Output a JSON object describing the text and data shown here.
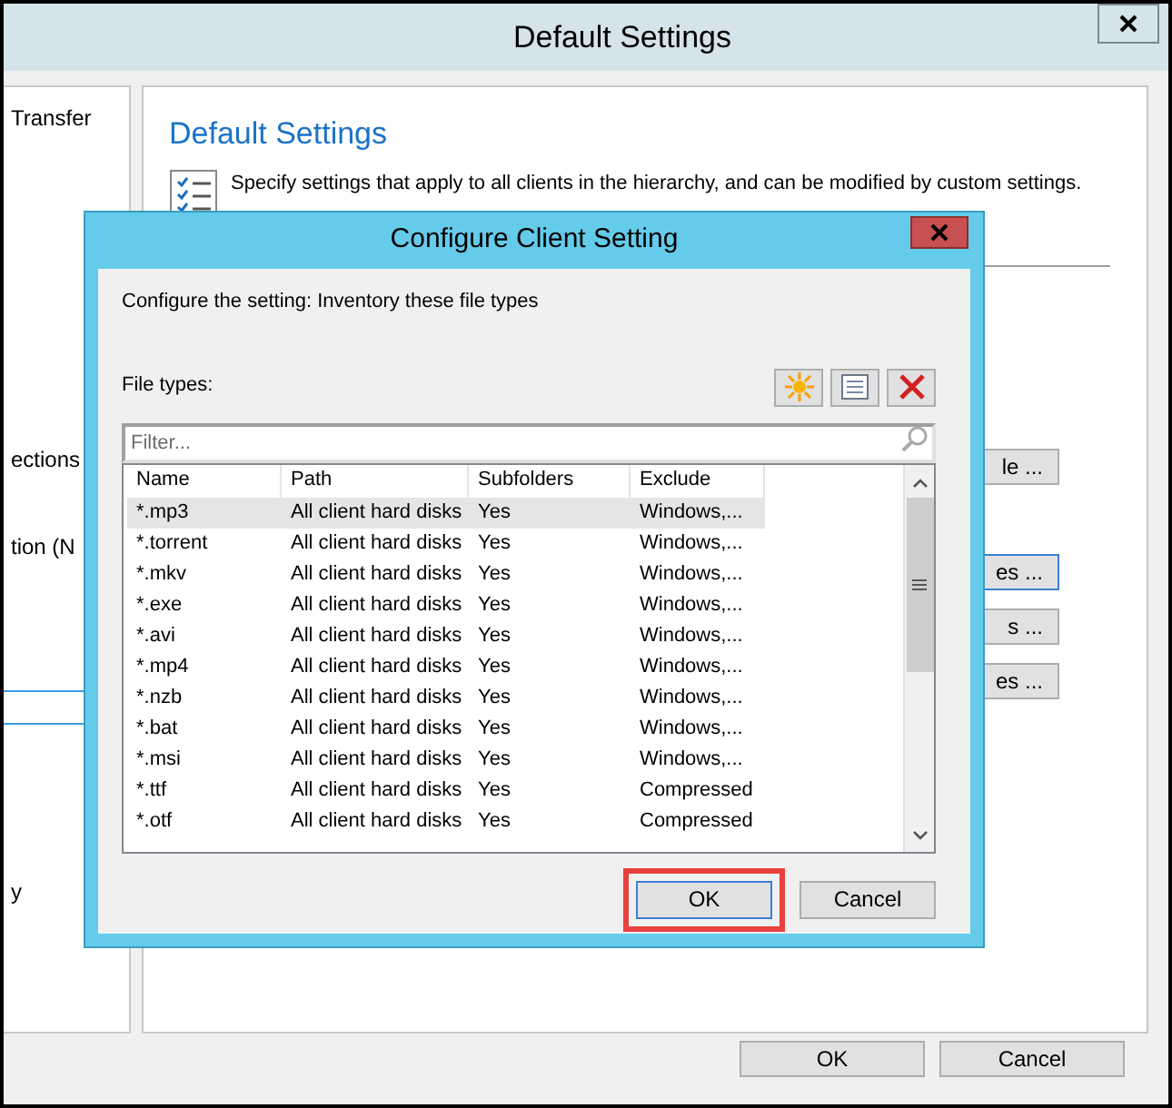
{
  "main_window": {
    "title": "Default Settings",
    "sidebar_items": [
      "Transfer",
      "ections",
      "tion (N",
      "y"
    ],
    "panel": {
      "heading": "Default Settings",
      "description": "Specify settings that apply to all clients in the hierarchy, and can be modified by custom settings.",
      "buttons": [
        {
          "label": "le ...",
          "focused": false
        },
        {
          "label": "es ...",
          "focused": true
        },
        {
          "label": "s ...",
          "focused": false
        },
        {
          "label": "es ...",
          "focused": false
        }
      ]
    },
    "buttons": [
      "OK",
      "Cancel"
    ]
  },
  "dialog": {
    "title": "Configure Client Setting",
    "setting_text": "Configure the setting: Inventory these file types",
    "list_label": "File types:",
    "filter": {
      "placeholder": "Filter..."
    },
    "table": {
      "columns": [
        "Name",
        "Path",
        "Subfolders",
        "Exclude"
      ],
      "rows": [
        {
          "cells": [
            "*.mp3",
            "All client hard disks",
            "Yes",
            "Windows,..."
          ],
          "selected": true
        },
        {
          "cells": [
            "*.torrent",
            "All client hard disks",
            "Yes",
            "Windows,..."
          ],
          "selected": false
        },
        {
          "cells": [
            "*.mkv",
            "All client hard disks",
            "Yes",
            "Windows,..."
          ],
          "selected": false
        },
        {
          "cells": [
            "*.exe",
            "All client hard disks",
            "Yes",
            "Windows,..."
          ],
          "selected": false
        },
        {
          "cells": [
            "*.avi",
            "All client hard disks",
            "Yes",
            "Windows,..."
          ],
          "selected": false
        },
        {
          "cells": [
            "*.mp4",
            "All client hard disks",
            "Yes",
            "Windows,..."
          ],
          "selected": false
        },
        {
          "cells": [
            "*.nzb",
            "All client hard disks",
            "Yes",
            "Windows,..."
          ],
          "selected": false
        },
        {
          "cells": [
            "*.bat",
            "All client hard disks",
            "Yes",
            "Windows,..."
          ],
          "selected": false
        },
        {
          "cells": [
            "*.msi",
            "All client hard disks",
            "Yes",
            "Windows,..."
          ],
          "selected": false
        },
        {
          "cells": [
            "*.ttf",
            "All client hard disks",
            "Yes",
            "Compressed"
          ],
          "selected": false
        },
        {
          "cells": [
            "*.otf",
            "All client hard disks",
            "Yes",
            "Compressed"
          ],
          "selected": false
        }
      ]
    },
    "buttons": [
      {
        "label": "OK",
        "highlighted": true
      },
      {
        "label": "Cancel",
        "highlighted": false
      }
    ]
  }
}
